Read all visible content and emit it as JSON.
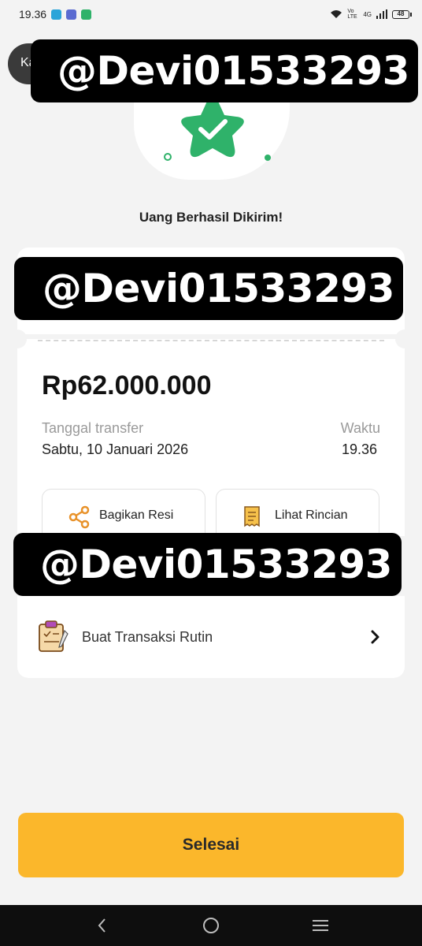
{
  "status_bar": {
    "time": "19.36",
    "network_label": "4G",
    "volte_label": "Vo LTE",
    "battery_level": "48",
    "app_icon_colors": [
      "#2aa4d9",
      "#5b6bd1",
      "#2fb26a"
    ]
  },
  "header": {
    "back_text": "Ka"
  },
  "watermarks": [
    {
      "text": "@Devi01533293"
    },
    {
      "text": "@Devi01533293"
    },
    {
      "text": "@Devi01533293"
    }
  ],
  "hero": {
    "icon": "success-star-check-icon",
    "color": "#2fb26a"
  },
  "success_title": "Uang Berhasil Dikirim!",
  "receipt": {
    "amount": "Rp62.000.000",
    "date_label": "Tanggal transfer",
    "date_value": "Sabtu, 10 Januari 2026",
    "time_label": "Waktu",
    "time_value": "19.36",
    "actions": [
      {
        "label": "Bagikan Resi",
        "icon": "share-icon"
      },
      {
        "label": "Lihat Rincian",
        "icon": "receipt-icon"
      }
    ]
  },
  "routine": {
    "label": "Buat Transaksi Rutin",
    "icon": "clipboard-icon"
  },
  "done_button": {
    "label": "Selesai",
    "color": "#fbb72b"
  },
  "navbar": {
    "items": [
      "back-icon",
      "home-icon",
      "menu-icon"
    ]
  }
}
